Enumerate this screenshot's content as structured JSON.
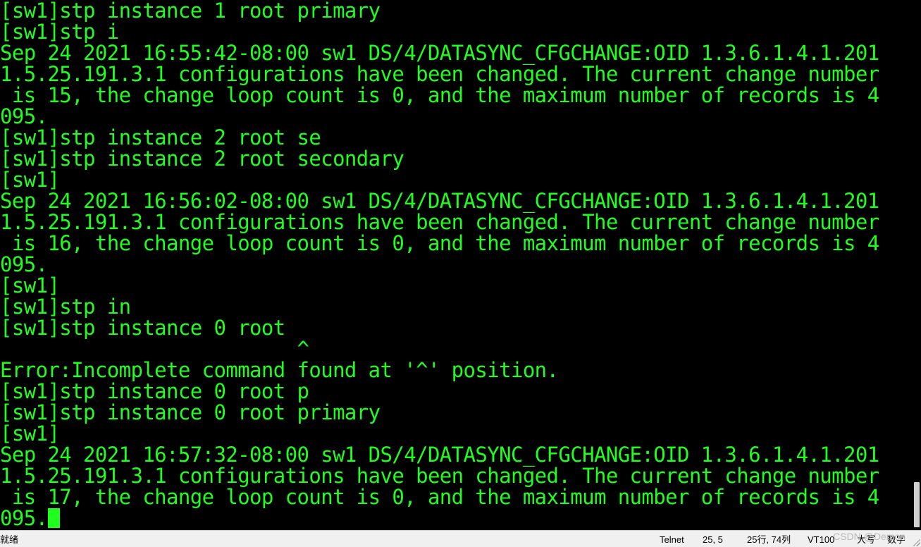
{
  "terminal": {
    "lines": [
      "[sw1]stp instance 1 root primary",
      "[sw1]stp i",
      "Sep 24 2021 16:55:42-08:00 sw1 DS/4/DATASYNC_CFGCHANGE:OID 1.3.6.1.4.1.201",
      "1.5.25.191.3.1 configurations have been changed. The current change number",
      " is 15, the change loop count is 0, and the maximum number of records is 4",
      "095.",
      "[sw1]stp instance 2 root se",
      "[sw1]stp instance 2 root secondary",
      "[sw1]",
      "Sep 24 2021 16:56:02-08:00 sw1 DS/4/DATASYNC_CFGCHANGE:OID 1.3.6.1.4.1.201",
      "1.5.25.191.3.1 configurations have been changed. The current change number",
      " is 16, the change loop count is 0, and the maximum number of records is 4",
      "095.",
      "[sw1]",
      "[sw1]stp in",
      "[sw1]stp instance 0 root",
      "                         ^",
      "Error:Incomplete command found at '^' position.",
      "[sw1]stp instance 0 root p",
      "[sw1]stp instance 0 root primary",
      "[sw1]",
      "Sep 24 2021 16:57:32-08:00 sw1 DS/4/DATASYNC_CFGCHANGE:OID 1.3.6.1.4.1.201",
      "1.5.25.191.3.1 configurations have been changed. The current change number",
      " is 17, the change loop count is 0, and the maximum number of records is 4",
      "095."
    ]
  },
  "status_bar": {
    "ready": "就绪",
    "protocol": "Telnet",
    "cursor_pos": "25,  5",
    "row_col": "25行, 74列",
    "emulation": "VT100",
    "caps": "大写",
    "numlock": "数字"
  },
  "watermark": "CSDN @Demon",
  "colors": {
    "terminal_bg": "#000000",
    "terminal_fg": "#1eff1e",
    "statusbar_bg": "#f0f0f0"
  }
}
